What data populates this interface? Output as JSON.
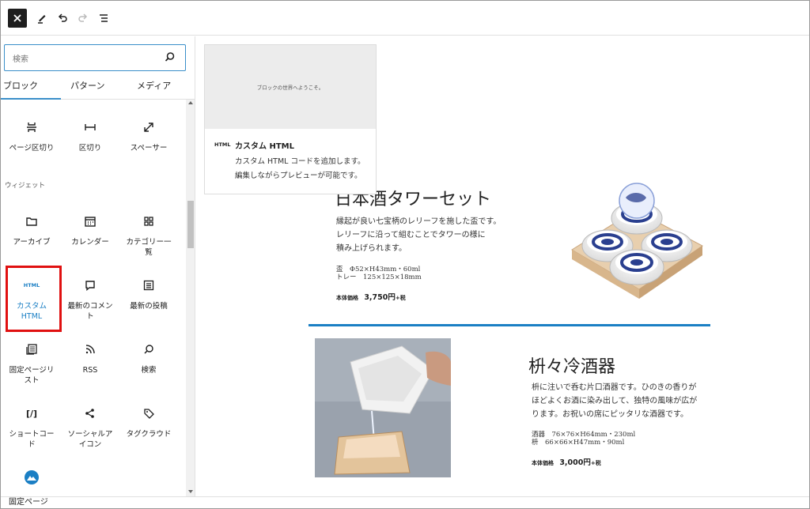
{
  "toolbar": {
    "close_icon": "close-icon",
    "tools_icon": "pencil-icon",
    "undo_icon": "undo-icon",
    "redo_icon": "redo-icon",
    "outline_icon": "list-view-icon"
  },
  "inserter": {
    "search_placeholder": "検索",
    "tabs": [
      {
        "label": "ブロック"
      },
      {
        "label": "パターン"
      },
      {
        "label": "メディア"
      }
    ],
    "blocks_top": [
      {
        "label": "ページ区切り",
        "icon": "page-break-icon"
      },
      {
        "label": "区切り",
        "icon": "separator-icon"
      },
      {
        "label": "スペーサー",
        "icon": "spacer-icon"
      }
    ],
    "widgets_label": "ウィジェット",
    "widgets": [
      {
        "label": "アーカイブ",
        "icon": "folder-icon"
      },
      {
        "label": "カレンダー",
        "icon": "calendar-icon"
      },
      {
        "label": "カテゴリー一覧",
        "icon": "grid-icon"
      },
      {
        "label": "カスタム HTML",
        "icon": "html-icon",
        "icon_text": "HTML"
      },
      {
        "label": "最新のコメント",
        "icon": "comment-icon"
      },
      {
        "label": "最新の投稿",
        "icon": "posts-icon"
      },
      {
        "label": "固定ページリスト",
        "icon": "pages-icon"
      },
      {
        "label": "RSS",
        "icon": "rss-icon"
      },
      {
        "label": "検索",
        "icon": "search-icon"
      },
      {
        "label": "ショートコード",
        "icon": "shortcode-icon",
        "icon_text": "[/]"
      },
      {
        "label": "ソーシャルアイコン",
        "icon": "share-icon"
      },
      {
        "label": "タグクラウド",
        "icon": "tag-icon"
      }
    ]
  },
  "preview": {
    "placeholder": "ブロックの世界へようこそ。",
    "tag": "HTML",
    "title": "カスタム HTML",
    "desc1": "カスタム HTML コードを追加します。",
    "desc2": "編集しながらプレビューが可能です。"
  },
  "product1": {
    "title": "日本酒タワーセット",
    "desc1": "縁起が良い七宝柄のレリーフを施した盃です。",
    "desc2": "レリーフに沿って組むことでタワーの様に",
    "desc3": "積み上げられます。",
    "spec1": "盃　Φ52×H43mm・60ml",
    "spec2": "トレー　125×125×18mm",
    "price_label": "本体価格",
    "price": "3,750円",
    "tax": "+税"
  },
  "product2": {
    "title": "枡々冷酒器",
    "desc1": "枡に注いで呑む片口酒器です。ひのきの香りが",
    "desc2": "ほどよくお酒に染み出して、独特の風味が広が",
    "desc3": "ります。お祝いの席にピッタリな酒器です。",
    "spec1": "酒器　76×76×H64mm・230ml",
    "spec2": "枡　66×66×H47mm・90ml",
    "price_label": "本体価格",
    "price": "3,000円",
    "tax": "+税"
  },
  "status": {
    "breadcrumb": "固定ページ"
  },
  "colors": {
    "accent": "#3a8fc9",
    "divider": "#1b7fc4",
    "highlight": "#e01010"
  }
}
